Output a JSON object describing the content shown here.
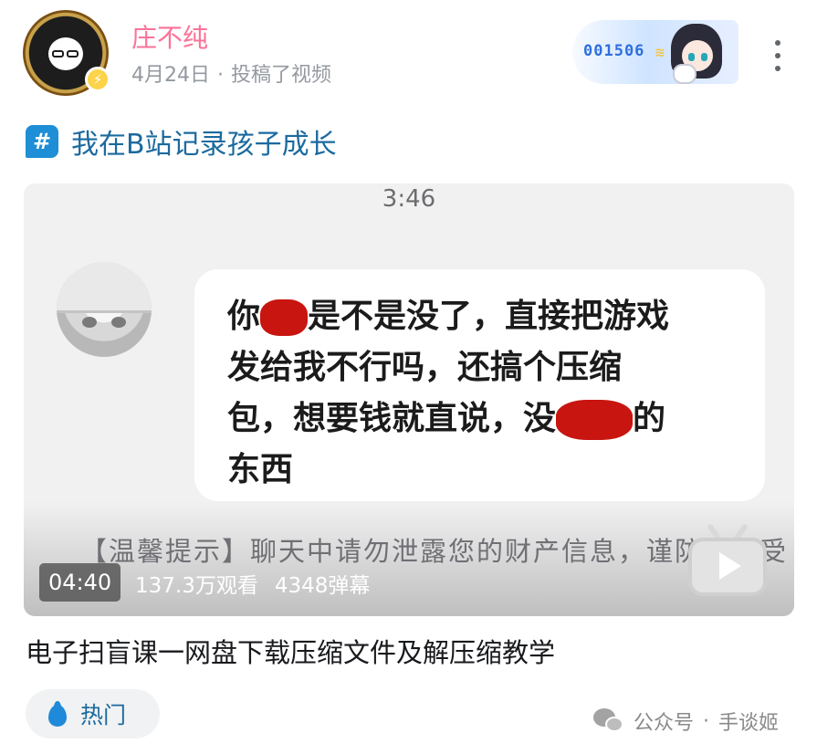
{
  "post": {
    "username": "庄不纯",
    "date": "4月24日",
    "dot": "·",
    "action": "投稿了视频",
    "fan_badge_number": "001506",
    "colors": {
      "username": "#fb7299",
      "topic": "#1b6a9f",
      "accent_blue": "#1e8ed6"
    }
  },
  "topic": {
    "icon": "#",
    "label": "我在B站记录孩子成长"
  },
  "video": {
    "screen_time": "3:46",
    "chat_lines": [
      [
        "你",
        "",
        "是不是没了，直接把游戏"
      ],
      [
        "发给我不行吗，还搞个压缩"
      ],
      [
        "包，想要钱就直说，没",
        "",
        "的"
      ],
      [
        "东西"
      ]
    ],
    "tip": "【温馨提示】聊天中请勿泄露您的财产信息，谨防上当受",
    "duration": "04:40",
    "views": "137.3万观看",
    "danmaku": "4348弹幕",
    "title": "电子扫盲课一网盘下载压缩文件及解压缩教学"
  },
  "tag": {
    "icon": "flame-icon",
    "label": "热门"
  },
  "watermark": {
    "source": "公众号",
    "dot": "·",
    "account": "手谈姬"
  }
}
